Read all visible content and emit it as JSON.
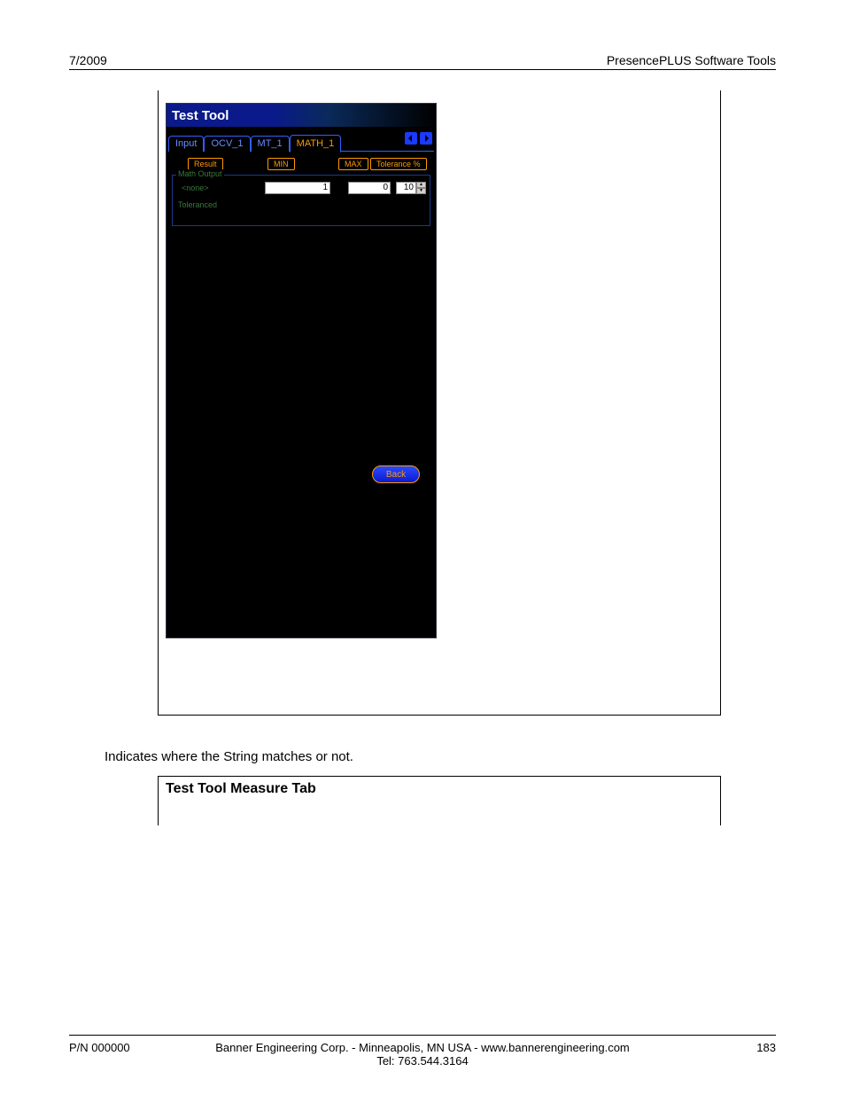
{
  "header": {
    "left": "7/2009",
    "right": "PresencePLUS Software Tools"
  },
  "tool": {
    "title": "Test Tool",
    "tabs": [
      "Input",
      "OCV_1",
      "MT_1",
      "MATH_1"
    ],
    "active_tab_index": 3,
    "columns": {
      "result": "Result",
      "min": "MIN",
      "max": "MAX",
      "tolerance": "Tolerance %"
    },
    "fieldset_label": "Math Output",
    "row": {
      "name": "<none>",
      "min": "1",
      "max": "0",
      "tol": "10"
    },
    "toleranced_label": "Toleranced",
    "back_label": "Back"
  },
  "caption": "Indicates where the String matches or not.",
  "measure": {
    "title": "Test Tool Measure Tab"
  },
  "footer": {
    "pn": "P/N 000000",
    "center1": "Banner Engineering Corp. - Minneapolis, MN USA - www.bannerengineering.com",
    "center2": "Tel: 763.544.3164",
    "page": "183"
  }
}
